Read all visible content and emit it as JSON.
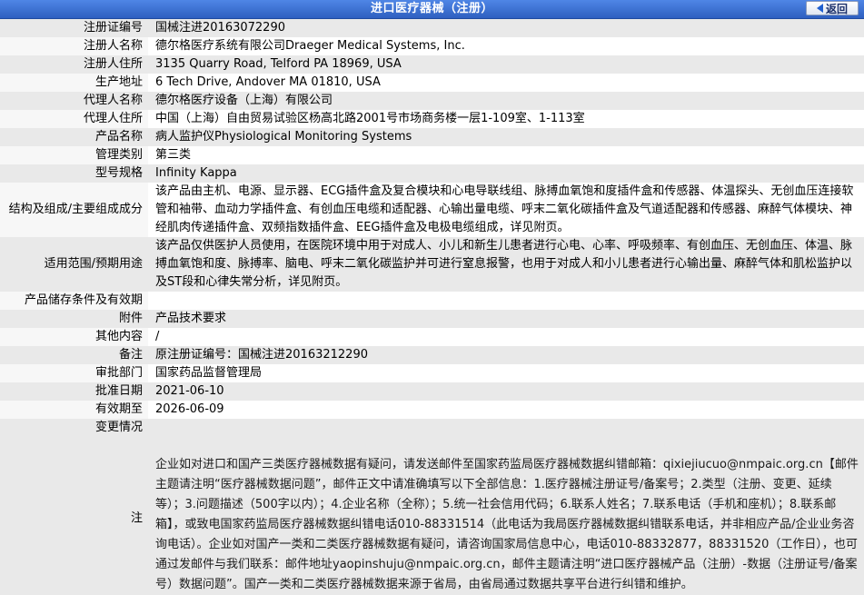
{
  "header": {
    "title": "进口医疗器械（注册）",
    "back_label": "返回"
  },
  "rows": [
    {
      "label": "注册证编号",
      "value": "国械注进20163072290"
    },
    {
      "label": "注册人名称",
      "value": "德尔格医疗系统有限公司Draeger Medical Systems, Inc."
    },
    {
      "label": "注册人住所",
      "value": "3135 Quarry Road, Telford PA 18969, USA"
    },
    {
      "label": "生产地址",
      "value": "6 Tech Drive, Andover MA 01810, USA"
    },
    {
      "label": "代理人名称",
      "value": "德尔格医疗设备（上海）有限公司"
    },
    {
      "label": "代理人住所",
      "value": "中国（上海）自由贸易试验区杨高北路2001号市场商务楼一层1-109室、1-113室"
    },
    {
      "label": "产品名称",
      "value": "病人监护仪Physiological Monitoring Systems"
    },
    {
      "label": "管理类别",
      "value": "第三类"
    },
    {
      "label": "型号规格",
      "value": "Infinity Kappa"
    },
    {
      "label": "结构及组成/主要组成成分",
      "value": "该产品由主机、电源、显示器、ECG插件盒及复合模块和心电导联线组、脉搏血氧饱和度插件盒和传感器、体温探头、无创血压连接软管和袖带、血动力学插件盒、有创血压电缆和适配器、心输出量电缆、呼末二氧化碳插件盒及气道适配器和传感器、麻醉气体模块、神经肌肉传递插件盒、双频指数插件盒、EEG插件盒及电极电缆组成，详见附页。"
    },
    {
      "label": "适用范围/预期用途",
      "value": "该产品仅供医护人员使用，在医院环境中用于对成人、小儿和新生儿患者进行心电、心率、呼吸频率、有创血压、无创血压、体温、脉搏血氧饱和度、脉搏率、脑电、呼末二氧化碳监护并可进行窒息报警，也用于对成人和小儿患者进行心输出量、麻醉气体和肌松监护以及ST段和心律失常分析，详见附页。"
    },
    {
      "label": "产品储存条件及有效期",
      "value": ""
    },
    {
      "label": "附件",
      "value": "产品技术要求"
    },
    {
      "label": "其他内容",
      "value": "/"
    },
    {
      "label": "备注",
      "value": "原注册证编号：国械注进20163212290"
    },
    {
      "label": "审批部门",
      "value": "国家药品监督管理局"
    },
    {
      "label": "批准日期",
      "value": "2021-06-10"
    },
    {
      "label": "有效期至",
      "value": "2026-06-09"
    },
    {
      "label": "变更情况",
      "value": ""
    }
  ],
  "note": {
    "label": "注",
    "text": "企业如对进口和国产三类医疗器械数据有疑问，请发送邮件至国家药监局医疗器械数据纠错邮箱：qixiejiucuo@nmpaic.org.cn【邮件主题请注明“医疗器械数据问题”，邮件正文中请准确填写以下全部信息：1.医疗器械注册证号/备案号；2.类型（注册、变更、延续等）；3.问题描述（500字以内）；4.企业名称（全称）；5.统一社会信用代码；6.联系人姓名；7.联系电话（手机和座机）；8.联系邮箱】，或致电国家药监局医疗器械数据纠错电话010-88331514（此电话为我局医疗器械数据纠错联系电话，并非相应产品/企业业务咨询电话）。企业如对国产一类和二类医疗器械数据有疑问，请咨询国家局信息中心，电话010-88332877，88331520（工作日），也可通过发邮件与我们联系：邮件地址yaopinshuju@nmpaic.org.cn，邮件主题请注明“进口医疗器械产品（注册）-数据（注册证号/备案号）数据问题”。国产一类和二类医疗器械数据来源于省局，由省局通过数据共享平台进行纠错和维护。"
  }
}
